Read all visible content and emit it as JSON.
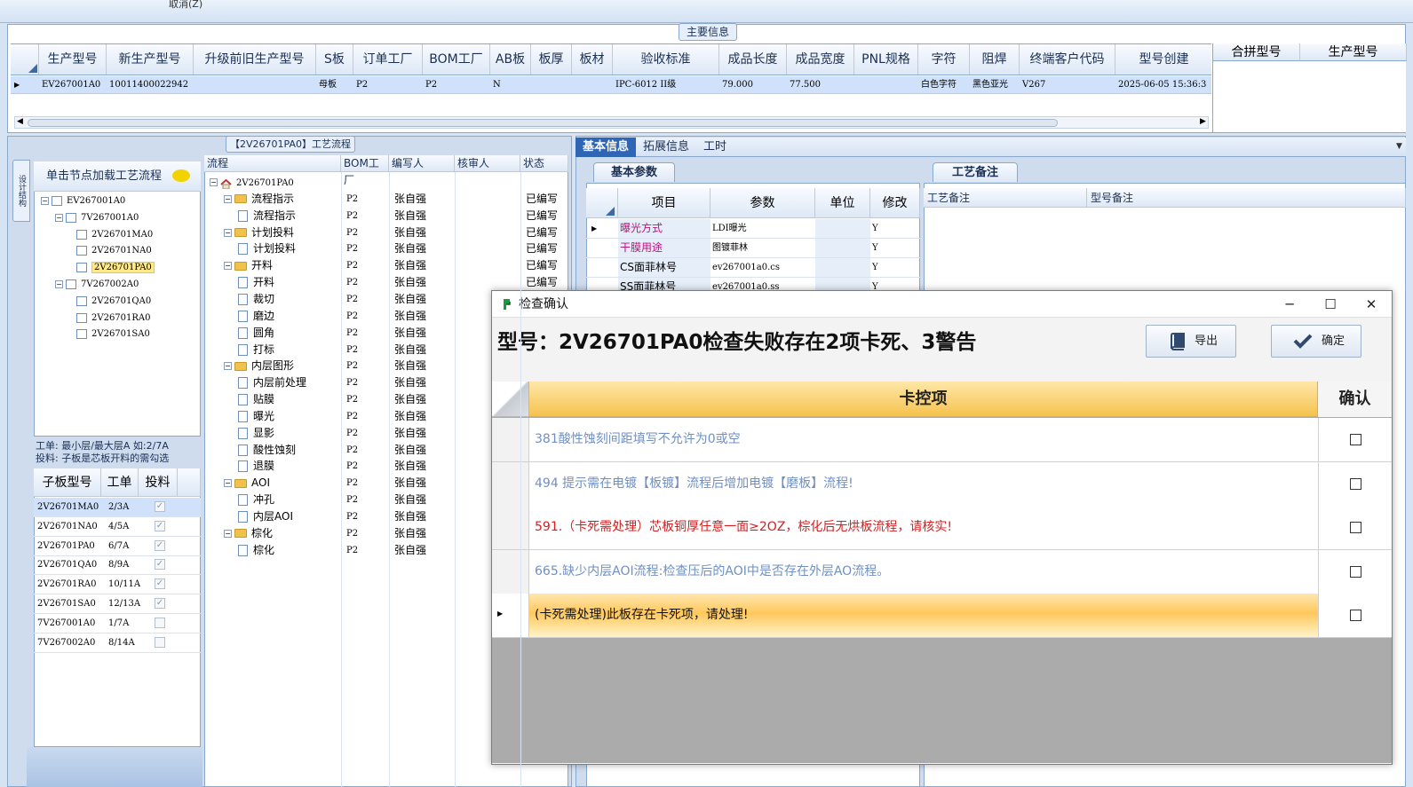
{
  "top_strip": {
    "cancel_label": "取消(Z)"
  },
  "main_info": {
    "title": "主要信息",
    "columns": [
      "生产型号",
      "新生产型号",
      "升级前旧生产型号",
      "S板",
      "订单工厂",
      "BOM工厂",
      "AB板",
      "板厚",
      "板材",
      "验收标准",
      "成品长度",
      "成品宽度",
      "PNL规格",
      "字符",
      "阻焊",
      "终端客户代码",
      "型号创建"
    ],
    "row": [
      "EV267001A0",
      "10011400022942",
      "",
      "母板",
      "P2",
      "P2",
      "N",
      "",
      "",
      "IPC-6012 II级",
      "79.000",
      "77.500",
      "",
      "白色字符",
      "黑色亚光",
      "V267",
      "2025-06-05 15:36:3"
    ],
    "merge_columns": [
      "合拼型号",
      "生产型号"
    ]
  },
  "process": {
    "title": "【2V26701PA0】工艺流程",
    "side_tab": "设计结构",
    "tree_header": "单击节点加载工艺流程",
    "tree": [
      {
        "label": "EV267001A0",
        "level": 0,
        "sel": false
      },
      {
        "label": "7V267001A0",
        "level": 1,
        "sel": false
      },
      {
        "label": "2V26701MA0",
        "level": 2,
        "sel": false
      },
      {
        "label": "2V26701NA0",
        "level": 2,
        "sel": false
      },
      {
        "label": "2V26701PA0",
        "level": 2,
        "sel": true
      },
      {
        "label": "7V267002A0",
        "level": 1,
        "sel": false
      },
      {
        "label": "2V26701QA0",
        "level": 2,
        "sel": false
      },
      {
        "label": "2V26701RA0",
        "level": 2,
        "sel": false
      },
      {
        "label": "2V26701SA0",
        "level": 2,
        "sel": false
      }
    ],
    "note_line1": "工单: 最小层/最大层A 如:2/7A",
    "note_line2": "投料: 子板是芯板开料的需勾选",
    "sub_columns": [
      "子板型号",
      "工单",
      "投料"
    ],
    "sub_rows": [
      {
        "model": "2V26701MA0",
        "order": "2/3A",
        "feed": true,
        "sel": true
      },
      {
        "model": "2V26701NA0",
        "order": "4/5A",
        "feed": true,
        "sel": false
      },
      {
        "model": "2V26701PA0",
        "order": "6/7A",
        "feed": true,
        "sel": false
      },
      {
        "model": "2V26701QA0",
        "order": "8/9A",
        "feed": true,
        "sel": false
      },
      {
        "model": "2V26701RA0",
        "order": "10/11A",
        "feed": true,
        "sel": false
      },
      {
        "model": "2V26701SA0",
        "order": "12/13A",
        "feed": true,
        "sel": false
      },
      {
        "model": "7V267001A0",
        "order": "1/7A",
        "feed": false,
        "sel": false
      },
      {
        "model": "7V267002A0",
        "order": "8/14A",
        "feed": false,
        "sel": false
      }
    ],
    "flow_columns": [
      "流程",
      "BOM工厂",
      "编写人",
      "核审人",
      "状态"
    ],
    "flow_rows": [
      {
        "name": "2V26701PA0",
        "type": "root",
        "level": 0,
        "bom": "",
        "writer": "",
        "status": ""
      },
      {
        "name": "流程指示",
        "type": "folder",
        "level": 1,
        "bom": "P2",
        "writer": "张自强",
        "status": "已编写"
      },
      {
        "name": "流程指示",
        "type": "doc",
        "level": 2,
        "bom": "P2",
        "writer": "张自强",
        "status": "已编写"
      },
      {
        "name": "计划投料",
        "type": "folder",
        "level": 1,
        "bom": "P2",
        "writer": "张自强",
        "status": "已编写"
      },
      {
        "name": "计划投料",
        "type": "doc",
        "level": 2,
        "bom": "P2",
        "writer": "张自强",
        "status": "已编写"
      },
      {
        "name": "开料",
        "type": "folder",
        "level": 1,
        "bom": "P2",
        "writer": "张自强",
        "status": "已编写"
      },
      {
        "name": "开料",
        "type": "doc",
        "level": 2,
        "bom": "P2",
        "writer": "张自强",
        "status": "已编写"
      },
      {
        "name": "裁切",
        "type": "doc",
        "level": 2,
        "bom": "P2",
        "writer": "张自强",
        "status": ""
      },
      {
        "name": "磨边",
        "type": "doc",
        "level": 2,
        "bom": "P2",
        "writer": "张自强",
        "status": ""
      },
      {
        "name": "圆角",
        "type": "doc",
        "level": 2,
        "bom": "P2",
        "writer": "张自强",
        "status": ""
      },
      {
        "name": "打标",
        "type": "doc",
        "level": 2,
        "bom": "P2",
        "writer": "张自强",
        "status": ""
      },
      {
        "name": "内层图形",
        "type": "folder",
        "level": 1,
        "bom": "P2",
        "writer": "张自强",
        "status": ""
      },
      {
        "name": "内层前处理",
        "type": "doc",
        "level": 2,
        "bom": "P2",
        "writer": "张自强",
        "status": ""
      },
      {
        "name": "贴膜",
        "type": "doc",
        "level": 2,
        "bom": "P2",
        "writer": "张自强",
        "status": ""
      },
      {
        "name": "曝光",
        "type": "doc",
        "level": 2,
        "bom": "P2",
        "writer": "张自强",
        "status": ""
      },
      {
        "name": "显影",
        "type": "doc",
        "level": 2,
        "bom": "P2",
        "writer": "张自强",
        "status": ""
      },
      {
        "name": "酸性蚀刻",
        "type": "doc",
        "level": 2,
        "bom": "P2",
        "writer": "张自强",
        "status": ""
      },
      {
        "name": "退膜",
        "type": "doc",
        "level": 2,
        "bom": "P2",
        "writer": "张自强",
        "status": ""
      },
      {
        "name": "AOI",
        "type": "folder",
        "level": 1,
        "bom": "P2",
        "writer": "张自强",
        "status": ""
      },
      {
        "name": "冲孔",
        "type": "doc",
        "level": 2,
        "bom": "P2",
        "writer": "张自强",
        "status": ""
      },
      {
        "name": "内层AOI",
        "type": "doc",
        "level": 2,
        "bom": "P2",
        "writer": "张自强",
        "status": ""
      },
      {
        "name": "棕化",
        "type": "folder",
        "level": 1,
        "bom": "P2",
        "writer": "张自强",
        "status": ""
      },
      {
        "name": "棕化",
        "type": "doc",
        "level": 2,
        "bom": "P2",
        "writer": "张自强",
        "status": ""
      }
    ]
  },
  "right": {
    "tabs": [
      "基本信息",
      "拓展信息",
      "工时"
    ],
    "basic_title": "基本参数",
    "basic_columns": [
      "项目",
      "参数",
      "单位",
      "修改"
    ],
    "basic_rows": [
      {
        "item": "曝光方式",
        "param": "LDI曝光",
        "unit": "",
        "mod": "Y",
        "pink": true
      },
      {
        "item": "干膜用途",
        "param": "图镀菲林",
        "unit": "",
        "mod": "Y",
        "pink": true
      },
      {
        "item": "CS面菲林号",
        "param": "ev267001a0.cs",
        "unit": "",
        "mod": "Y",
        "pink": false
      },
      {
        "item": "SS面菲林号",
        "param": "ev267001a0.ss",
        "unit": "",
        "mod": "Y",
        "pink": false
      }
    ],
    "remark_title": "工艺备注",
    "remark_columns": [
      "工艺备注",
      "型号备注"
    ]
  },
  "dialog": {
    "title": "检查确认",
    "headline": "型号：2V26701PA0检查失败存在2项卡死、3警告",
    "export_label": "导出",
    "ok_label": "确定",
    "col_item": "卡控项",
    "col_confirm": "确认",
    "rows": [
      {
        "text": "381酸性蚀刻间距填写不允许为0或空",
        "level": "warn"
      },
      {
        "text": "494 提示需在电镀【板镀】流程后增加电镀【磨板】流程!",
        "level": "warn"
      },
      {
        "text": "591.（卡死需处理）芯板铜厚任意一面≥2OZ，棕化后无烘板流程，请核实!",
        "level": "block"
      },
      {
        "text": "665.缺少内层AOI流程:检查压后的AOI中是否存在外层AO流程。",
        "level": "warn"
      },
      {
        "text": "(卡死需处理)此板存在卡死项，请处理!",
        "level": "current"
      }
    ],
    "colors": {
      "warn": "#6f8fc4",
      "block": "#d42020",
      "current": "#111111"
    }
  }
}
